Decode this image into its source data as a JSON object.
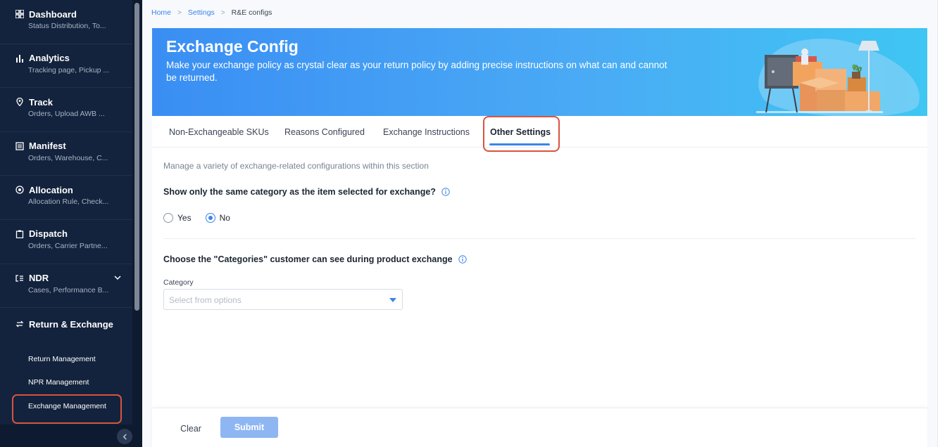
{
  "sidebar": {
    "items": [
      {
        "label": "Dashboard",
        "sub": "Status Distribution, To...",
        "icon": "grid-icon"
      },
      {
        "label": "Analytics",
        "sub": "Tracking page, Pickup ...",
        "icon": "bar-chart-icon"
      },
      {
        "label": "Track",
        "sub": "Orders, Upload AWB ...",
        "icon": "location-pin-icon"
      },
      {
        "label": "Manifest",
        "sub": "Orders, Warehouse, C...",
        "icon": "document-icon"
      },
      {
        "label": "Allocation",
        "sub": "Allocation Rule, Check...",
        "icon": "target-icon"
      },
      {
        "label": "Dispatch",
        "sub": "Orders, Carrier Partne...",
        "icon": "clipboard-icon"
      },
      {
        "label": "NDR",
        "sub": "Cases, Performance B...",
        "icon": "list-icon"
      },
      {
        "label": "Return & Exchange",
        "sub": "",
        "icon": "swap-icon"
      }
    ],
    "sub_items": [
      {
        "label": "Return Management"
      },
      {
        "label": "NPR Management"
      },
      {
        "label": "Exchange Management"
      }
    ]
  },
  "breadcrumb": {
    "home": "Home",
    "settings": "Settings",
    "current": "R&E configs"
  },
  "banner": {
    "title": "Exchange Config",
    "description": "Make your exchange policy as crystal clear as your return policy by adding precise instructions on what can and cannot be returned."
  },
  "tabs": [
    {
      "label": "Non-Exchangeable SKUs"
    },
    {
      "label": "Reasons Configured"
    },
    {
      "label": "Exchange Instructions"
    },
    {
      "label": "Other Settings"
    }
  ],
  "content": {
    "description": "Manage a variety of exchange-related configurations within this section",
    "question1": "Show only the same category as the item selected for exchange?",
    "radio_yes": "Yes",
    "radio_no": "No",
    "selected_option": "No",
    "question2": "Choose the \"Categories\" customer can see during product exchange",
    "category_label": "Category",
    "category_placeholder": "Select from options"
  },
  "footer": {
    "clear_label": "Clear",
    "submit_label": "Submit"
  },
  "colors": {
    "accent": "#3c84e8",
    "sidebar_bg": "#13233d",
    "highlight": "#d9533f"
  }
}
